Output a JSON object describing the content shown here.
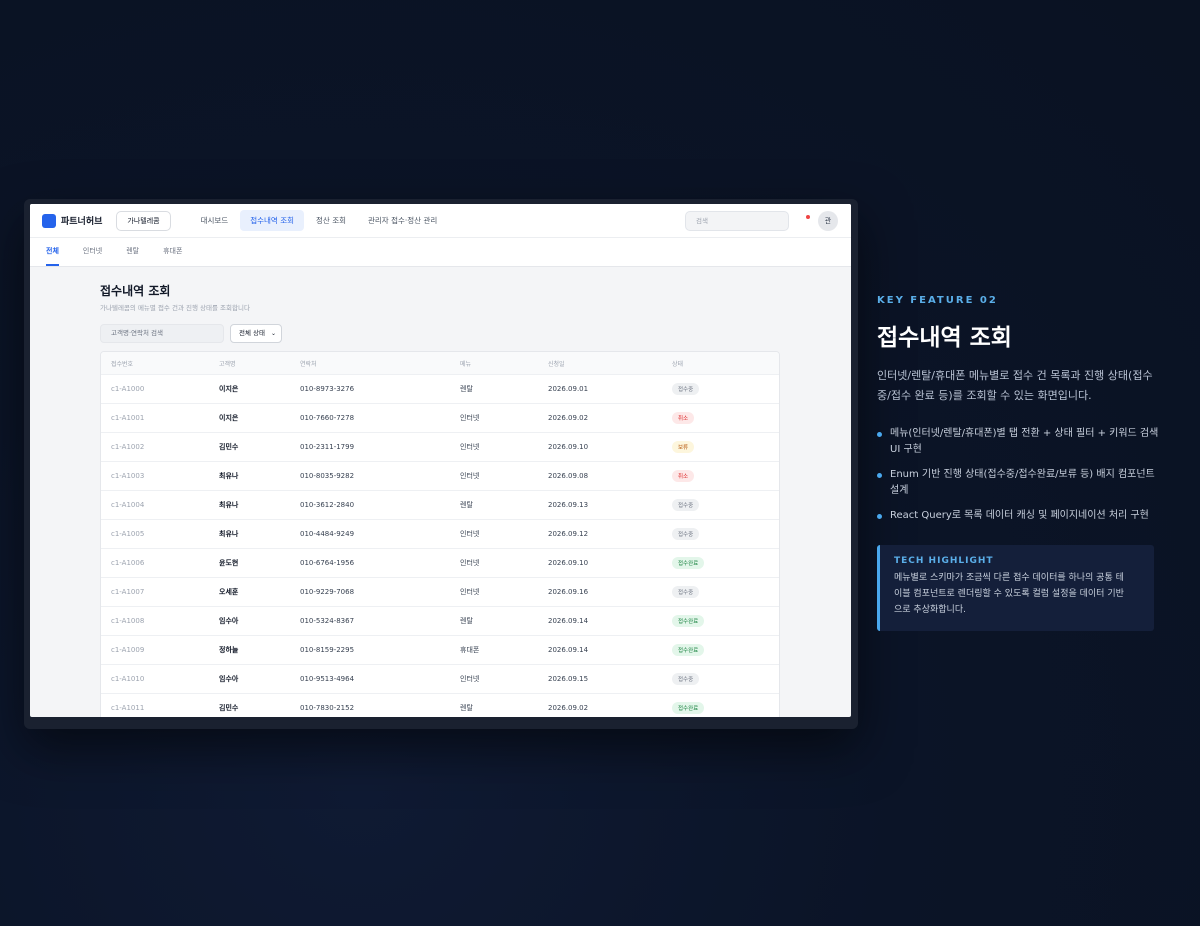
{
  "app": {
    "logo_text": "파트너허브",
    "partner_button": "가나텔레콤",
    "nav": [
      "대시보드",
      "접수내역 조회",
      "정산 조회",
      "관리자 접수·정산 관리"
    ],
    "search_placeholder": "검색",
    "avatar_initial": "관"
  },
  "subtabs": [
    "전체",
    "인터넷",
    "렌탈",
    "휴대폰"
  ],
  "page": {
    "title": "접수내역 조회",
    "subtitle": "가나텔레콤의 메뉴별 접수 건과 진행 상태를 조회합니다",
    "keyword_placeholder": "고객명·연락처 검색",
    "status_filter": "전체 상태"
  },
  "table": {
    "headers": [
      "접수번호",
      "고객명",
      "연락처",
      "메뉴",
      "신청일",
      "상태"
    ],
    "rows": [
      {
        "id": "c1-A1000",
        "name": "이지은",
        "phone": "010-8973-3276",
        "menu": "렌탈",
        "date": "2026.09.01",
        "status": "접수중",
        "tone": "gray"
      },
      {
        "id": "c1-A1001",
        "name": "이지은",
        "phone": "010-7660-7278",
        "menu": "인터넷",
        "date": "2026.09.02",
        "status": "취소",
        "tone": "red"
      },
      {
        "id": "c1-A1002",
        "name": "김민수",
        "phone": "010-2311-1799",
        "menu": "인터넷",
        "date": "2026.09.10",
        "status": "보류",
        "tone": "yellow"
      },
      {
        "id": "c1-A1003",
        "name": "최유나",
        "phone": "010-8035-9282",
        "menu": "인터넷",
        "date": "2026.09.08",
        "status": "취소",
        "tone": "red"
      },
      {
        "id": "c1-A1004",
        "name": "최유나",
        "phone": "010-3612-2840",
        "menu": "렌탈",
        "date": "2026.09.13",
        "status": "접수중",
        "tone": "gray"
      },
      {
        "id": "c1-A1005",
        "name": "최유나",
        "phone": "010-4484-9249",
        "menu": "인터넷",
        "date": "2026.09.12",
        "status": "접수중",
        "tone": "gray"
      },
      {
        "id": "c1-A1006",
        "name": "윤도현",
        "phone": "010-6764-1956",
        "menu": "인터넷",
        "date": "2026.09.10",
        "status": "접수완료",
        "tone": "green"
      },
      {
        "id": "c1-A1007",
        "name": "오세훈",
        "phone": "010-9229-7068",
        "menu": "인터넷",
        "date": "2026.09.16",
        "status": "접수중",
        "tone": "gray"
      },
      {
        "id": "c1-A1008",
        "name": "임수아",
        "phone": "010-5324-8367",
        "menu": "렌탈",
        "date": "2026.09.14",
        "status": "접수완료",
        "tone": "green"
      },
      {
        "id": "c1-A1009",
        "name": "정하늘",
        "phone": "010-8159-2295",
        "menu": "휴대폰",
        "date": "2026.09.14",
        "status": "접수완료",
        "tone": "green"
      },
      {
        "id": "c1-A1010",
        "name": "임수아",
        "phone": "010-9513-4964",
        "menu": "인터넷",
        "date": "2026.09.15",
        "status": "접수중",
        "tone": "gray"
      },
      {
        "id": "c1-A1011",
        "name": "김민수",
        "phone": "010-7830-2152",
        "menu": "렌탈",
        "date": "2026.09.02",
        "status": "접수완료",
        "tone": "green"
      }
    ]
  },
  "feature": {
    "label": "KEY FEATURE 02",
    "title": "접수내역 조회",
    "description": "인터넷/렌탈/휴대폰 메뉴별로 접수 건 목록과 진행 상태(접수중/접수 완료 등)를 조회할 수 있는 화면입니다.",
    "bullets": [
      "메뉴(인터넷/렌탈/휴대폰)별 탭 전환 + 상태 필터 + 키워드 검색 UI 구현",
      "Enum 기반 진행 상태(접수중/접수완료/보류 등) 배지 컴포넌트 설계",
      "React Query로 목록 데이터 캐싱 및 페이지네이션 처리 구현"
    ],
    "tech_title": "TECH HIGHLIGHT",
    "tech_body": "메뉴별로 스키마가 조금씩 다른 접수 데이터를 하나의 공통 테이블 컴포넌트로 렌더링할 수 있도록 컬럼 설정을 데이터 기반으로 추상화합니다."
  },
  "colors": {
    "background": "#0b1427",
    "accent": "#2563eb",
    "highlight": "#4aa8ee"
  }
}
